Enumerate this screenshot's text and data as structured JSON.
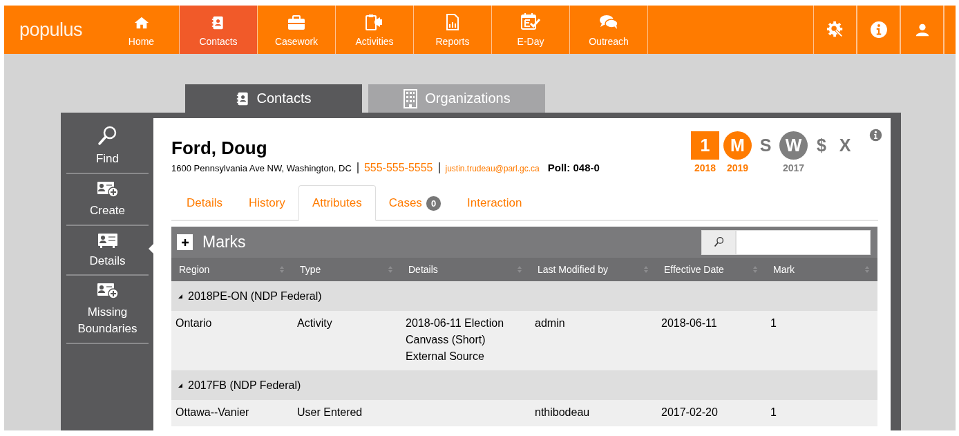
{
  "topbar": {
    "logo": "populus",
    "nav": [
      {
        "label": "Home",
        "selected": false
      },
      {
        "label": "Contacts",
        "selected": true
      },
      {
        "label": "Casework",
        "selected": false
      },
      {
        "label": "Activities",
        "selected": false
      },
      {
        "label": "Reports",
        "selected": false
      },
      {
        "label": "E-Day",
        "selected": false
      },
      {
        "label": "Outreach",
        "selected": false
      }
    ]
  },
  "section_tabs": [
    {
      "label": "Contacts",
      "selected": true
    },
    {
      "label": "Organizations",
      "selected": false
    }
  ],
  "sidebar": {
    "items": [
      {
        "label": "Find",
        "selected": false
      },
      {
        "label": "Create",
        "selected": false
      },
      {
        "label": "Details",
        "selected": true
      },
      {
        "label": "Missing Boundaries",
        "selected": false
      }
    ]
  },
  "contact": {
    "name": "Ford, Doug",
    "address": "1600 Pennsylvania Ave NW, Washington, DC",
    "phone": "555-555-5555",
    "email": "justin.trudeau@parl.gc.ca",
    "poll": "Poll: 048-0",
    "badges": [
      {
        "label": "1",
        "kind": "square",
        "color": "#ff7b00",
        "year": "2018"
      },
      {
        "label": "M",
        "kind": "circle",
        "color": "#ff7b00",
        "year": "2019"
      },
      {
        "label": "S",
        "kind": "letter"
      },
      {
        "label": "W",
        "kind": "circle",
        "color": "#7f7f7f",
        "year": "2017"
      },
      {
        "label": "$",
        "kind": "letter"
      },
      {
        "label": "X",
        "kind": "letter"
      }
    ]
  },
  "detail_tabs": [
    {
      "label": "Details",
      "selected": false
    },
    {
      "label": "History",
      "selected": false
    },
    {
      "label": "Attributes",
      "selected": true
    },
    {
      "label": "Cases",
      "count": "0",
      "selected": false
    },
    {
      "label": "Interaction",
      "selected": false
    }
  ],
  "marks": {
    "title": "Marks",
    "columns": [
      "Region",
      "Type",
      "Details",
      "Last Modified by",
      "Effective Date",
      "Mark"
    ],
    "groups": [
      {
        "title": "2018PE-ON (NDP Federal)",
        "expanded": true,
        "rows": [
          [
            "Ontario",
            "Activity",
            "2018-06-11 Election Canvass (Short) External Source",
            "admin",
            "2018-06-11",
            "1"
          ]
        ]
      },
      {
        "title": "2017FB (NDP Federal)",
        "expanded": true,
        "rows": [
          [
            "Ottawa--Vanier",
            "User Entered",
            "",
            "nthibodeau",
            "2017-02-20",
            "1"
          ]
        ]
      }
    ]
  }
}
